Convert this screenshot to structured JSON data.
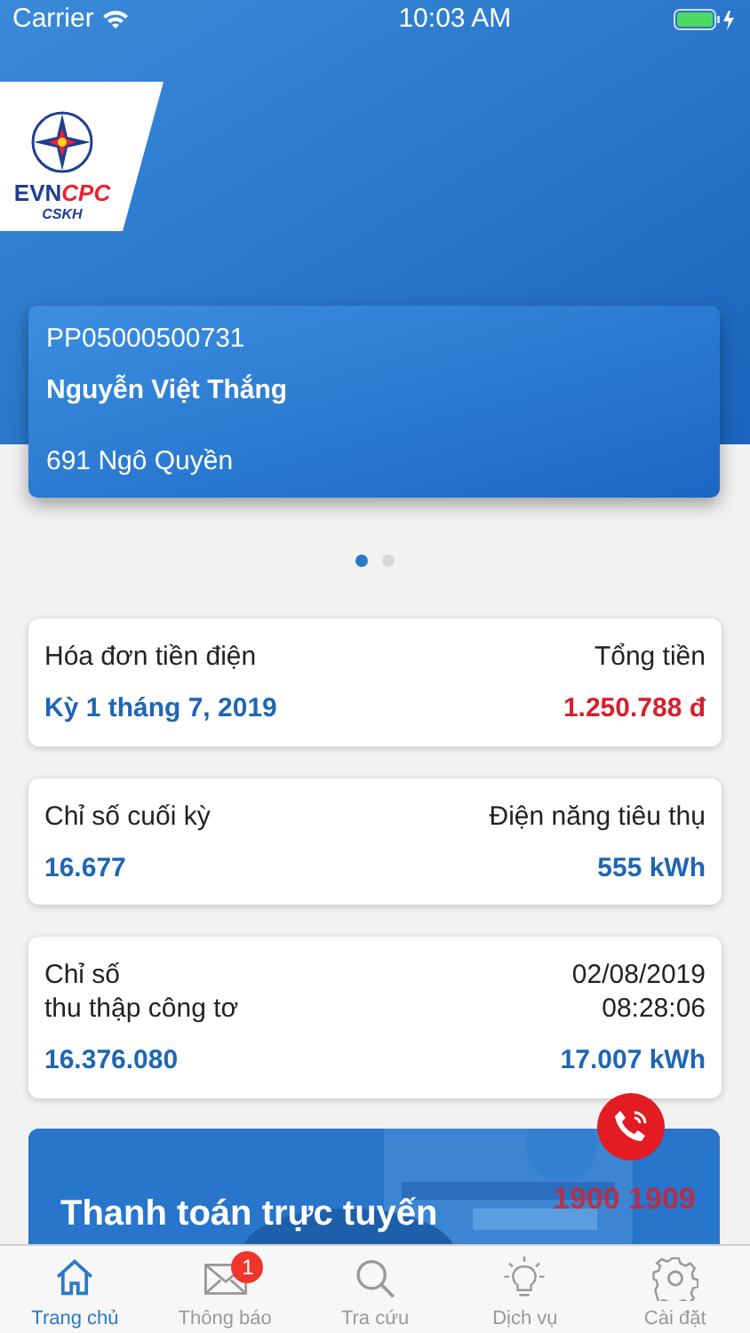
{
  "status_bar": {
    "carrier": "Carrier",
    "time": "10:03 AM"
  },
  "logo": {
    "brand_left": "EVN",
    "brand_right": "CPC",
    "subtitle": "CSKH"
  },
  "account": {
    "code": "PP05000500731",
    "name": "Nguyễn Việt Thắng",
    "address": "691 Ngô Quyền"
  },
  "pager": [
    {
      "selected": true
    },
    {
      "selected": false
    }
  ],
  "cards": [
    {
      "left_label": "Hóa đơn tiền điện",
      "right_label": "Tổng tiền",
      "left_value": "Kỳ 1 tháng 7, 2019",
      "right_value": "1.250.788 đ",
      "kind": "money"
    },
    {
      "left_label": "Chỉ số cuối kỳ",
      "right_label": "Điện năng tiêu thụ",
      "left_value": "16.677",
      "right_value": "555 kWh",
      "kind": "reading"
    },
    {
      "left_label": "Chỉ số\nthu thập công tơ",
      "right_label": "02/08/2019\n08:28:06",
      "left_value": "16.376.080",
      "right_value": "17.007 kWh",
      "kind": "reading"
    }
  ],
  "banner": {
    "title": "Thanh toán trực tuyến"
  },
  "hotline": {
    "number": "1900 1909"
  },
  "tabs": [
    {
      "label": "Trang chủ",
      "kind": "home",
      "selected": true
    },
    {
      "label": "Thông báo",
      "kind": "mail",
      "selected": false,
      "badge": "1"
    },
    {
      "label": "Tra cứu",
      "kind": "search",
      "selected": false
    },
    {
      "label": "Dịch vụ",
      "kind": "bulb",
      "selected": false
    },
    {
      "label": "Cài đặt",
      "kind": "gear",
      "selected": false
    }
  ]
}
